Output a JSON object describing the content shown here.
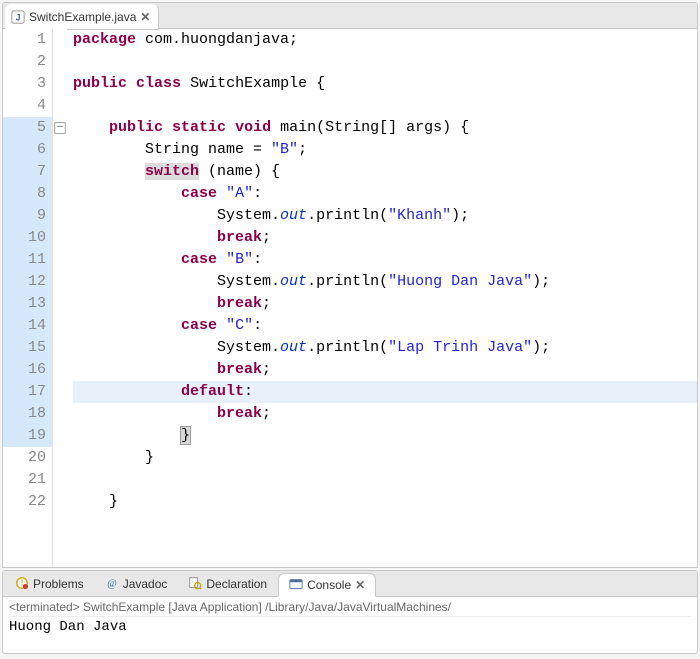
{
  "editor": {
    "tab": {
      "filename": "SwitchExample.java",
      "close_glyph": "✕"
    },
    "lines": [
      {
        "n": 1,
        "tokens": [
          [
            "kw",
            "package"
          ],
          [
            "sp",
            " "
          ],
          [
            "pkg",
            "com.huongdanjava;"
          ]
        ]
      },
      {
        "n": 2,
        "tokens": []
      },
      {
        "n": 3,
        "tokens": [
          [
            "kw",
            "public"
          ],
          [
            "sp",
            " "
          ],
          [
            "kw",
            "class"
          ],
          [
            "sp",
            " "
          ],
          [
            "type",
            "SwitchExample {"
          ]
        ]
      },
      {
        "n": 4,
        "tokens": []
      },
      {
        "n": 5,
        "fold": true,
        "hl_gutter": true,
        "tokens": [
          [
            "sp",
            "    "
          ],
          [
            "kw",
            "public"
          ],
          [
            "sp",
            " "
          ],
          [
            "kw",
            "static"
          ],
          [
            "sp",
            " "
          ],
          [
            "kw",
            "void"
          ],
          [
            "sp",
            " "
          ],
          [
            "type",
            "main(String[] args) {"
          ]
        ]
      },
      {
        "n": 6,
        "hl_gutter": true,
        "tokens": [
          [
            "sp",
            "        "
          ],
          [
            "type",
            "String name = "
          ],
          [
            "str",
            "\"B\""
          ],
          [
            "type",
            ";"
          ]
        ]
      },
      {
        "n": 7,
        "hl_gutter": true,
        "tokens": [
          [
            "sp",
            "        "
          ],
          [
            "swhl",
            "switch"
          ],
          [
            "type",
            " (name) {"
          ]
        ]
      },
      {
        "n": 8,
        "hl_gutter": true,
        "tokens": [
          [
            "sp",
            "            "
          ],
          [
            "kw",
            "case"
          ],
          [
            "sp",
            " "
          ],
          [
            "str",
            "\"A\""
          ],
          [
            "type",
            ":"
          ]
        ]
      },
      {
        "n": 9,
        "hl_gutter": true,
        "tokens": [
          [
            "sp",
            "                "
          ],
          [
            "type",
            "System."
          ],
          [
            "field",
            "out"
          ],
          [
            "type",
            ".println("
          ],
          [
            "str",
            "\"Khanh\""
          ],
          [
            "type",
            ");"
          ]
        ]
      },
      {
        "n": 10,
        "hl_gutter": true,
        "tokens": [
          [
            "sp",
            "                "
          ],
          [
            "kw",
            "break"
          ],
          [
            "type",
            ";"
          ]
        ]
      },
      {
        "n": 11,
        "hl_gutter": true,
        "tokens": [
          [
            "sp",
            "            "
          ],
          [
            "kw",
            "case"
          ],
          [
            "sp",
            " "
          ],
          [
            "str",
            "\"B\""
          ],
          [
            "type",
            ":"
          ]
        ]
      },
      {
        "n": 12,
        "hl_gutter": true,
        "tokens": [
          [
            "sp",
            "                "
          ],
          [
            "type",
            "System."
          ],
          [
            "field",
            "out"
          ],
          [
            "type",
            ".println("
          ],
          [
            "str",
            "\"Huong Dan Java\""
          ],
          [
            "type",
            ");"
          ]
        ]
      },
      {
        "n": 13,
        "hl_gutter": true,
        "tokens": [
          [
            "sp",
            "                "
          ],
          [
            "kw",
            "break"
          ],
          [
            "type",
            ";"
          ]
        ]
      },
      {
        "n": 14,
        "hl_gutter": true,
        "tokens": [
          [
            "sp",
            "            "
          ],
          [
            "kw",
            "case"
          ],
          [
            "sp",
            " "
          ],
          [
            "str",
            "\"C\""
          ],
          [
            "type",
            ":"
          ]
        ]
      },
      {
        "n": 15,
        "hl_gutter": true,
        "tokens": [
          [
            "sp",
            "                "
          ],
          [
            "type",
            "System."
          ],
          [
            "field",
            "out"
          ],
          [
            "type",
            ".println("
          ],
          [
            "str",
            "\"Lap Trinh Java\""
          ],
          [
            "type",
            ");"
          ]
        ]
      },
      {
        "n": 16,
        "hl_gutter": true,
        "tokens": [
          [
            "sp",
            "                "
          ],
          [
            "kw",
            "break"
          ],
          [
            "type",
            ";"
          ]
        ]
      },
      {
        "n": 17,
        "hl_gutter": true,
        "current": true,
        "tokens": [
          [
            "sp",
            "            "
          ],
          [
            "kw",
            "default"
          ],
          [
            "type",
            ":"
          ]
        ]
      },
      {
        "n": 18,
        "hl_gutter": true,
        "tokens": [
          [
            "sp",
            "                "
          ],
          [
            "kw",
            "break"
          ],
          [
            "type",
            ";"
          ]
        ]
      },
      {
        "n": 19,
        "hl_gutter": true,
        "tokens": [
          [
            "sp",
            "            "
          ],
          [
            "box",
            "}"
          ]
        ]
      },
      {
        "n": 20,
        "tokens": [
          [
            "sp",
            "        "
          ],
          [
            "type",
            "}"
          ]
        ]
      },
      {
        "n": 21,
        "tokens": []
      },
      {
        "n": 22,
        "tokens": [
          [
            "sp",
            "    "
          ],
          [
            "type",
            "}"
          ]
        ]
      }
    ]
  },
  "bottom": {
    "tabs": [
      {
        "label": "Problems",
        "icon": "problems"
      },
      {
        "label": "Javadoc",
        "icon": "javadoc"
      },
      {
        "label": "Declaration",
        "icon": "declaration"
      },
      {
        "label": "Console",
        "icon": "console",
        "active": true,
        "close_glyph": "✕"
      }
    ],
    "status": "<terminated> SwitchExample [Java Application] /Library/Java/JavaVirtualMachines/",
    "output": "Huong Dan Java"
  }
}
